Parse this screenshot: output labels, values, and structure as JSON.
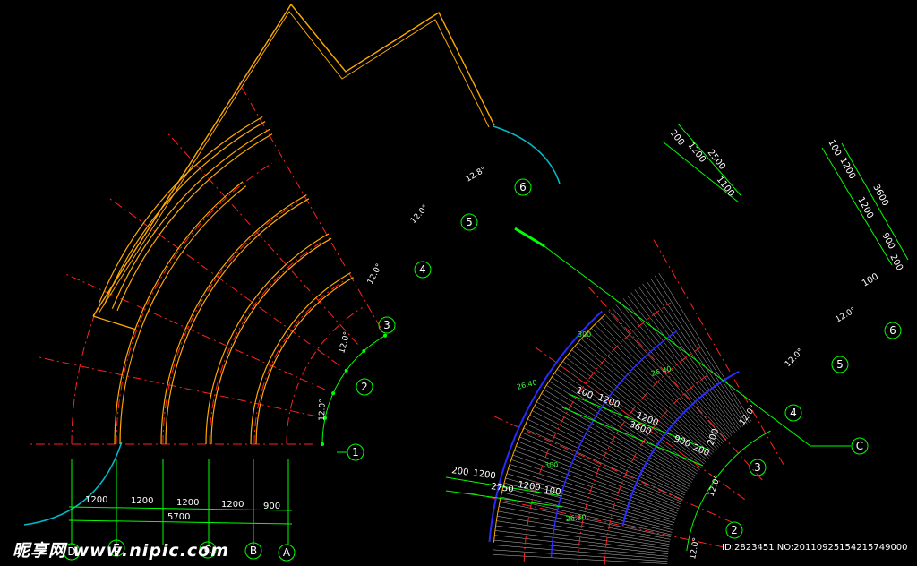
{
  "left_plan": {
    "dims": [
      "1200",
      "1200",
      "1200",
      "1200",
      "900"
    ],
    "total": "5700",
    "angles": [
      "12.0°",
      "12.0°",
      "12.0°",
      "12.0°",
      "12.8°"
    ],
    "axis_numbers": [
      "1",
      "2",
      "3",
      "4",
      "5",
      "6"
    ],
    "axis_letters": [
      "D",
      "E",
      "C",
      "B",
      "A"
    ]
  },
  "right_plan": {
    "axis_numbers": [
      "1",
      "2",
      "3",
      "4",
      "5",
      "6"
    ],
    "axis_letter": "C",
    "angles": [
      "12.0°",
      "12.0°",
      "12.0°",
      "12.0°",
      "12.0°"
    ],
    "top_dims": [
      "200",
      "1200",
      "2500",
      "1100"
    ],
    "right_dims": [
      "100",
      "1200",
      "3600",
      "1200",
      "900",
      "200"
    ],
    "mid_dims": [
      "1200",
      "1200",
      "3600",
      "900",
      "200"
    ],
    "bottom_dims": [
      "200",
      "1200",
      "2750",
      "1200",
      "100"
    ],
    "extra_dims": [
      "100",
      "200",
      "100"
    ],
    "notes": [
      "26.40",
      "26.40",
      "26.30",
      "300",
      "300"
    ]
  },
  "watermark": {
    "logo": "昵享网 www.nipic.com",
    "id": "ID:2823451 NO:20110925154215749000"
  },
  "colors": {
    "background": "#000000",
    "wall": "#ffaa00",
    "axis": "#ff2020",
    "dimension": "#00ff00",
    "stair_edge": "#2a2aff",
    "stair_tread": "#ffffff",
    "arc_cyan": "#00bbcc"
  }
}
